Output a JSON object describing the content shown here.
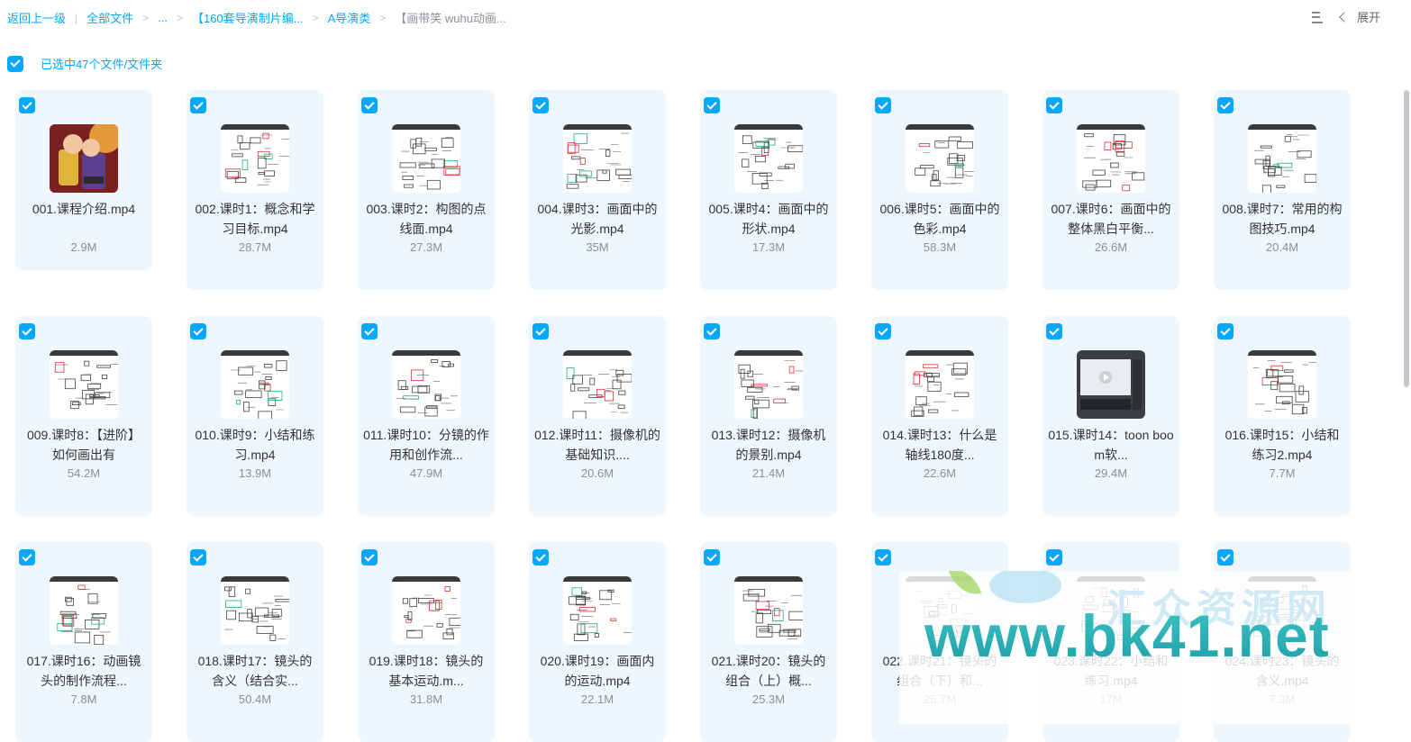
{
  "breadcrumb": {
    "back": "返回上一级",
    "root": "全部文件",
    "ellipsis": "...",
    "folder1": "【160套导演制片编...",
    "folder2": "A导演类",
    "current": "【画带笑 wuhu动画..."
  },
  "toolbar": {
    "expand_label": "展开"
  },
  "selection": {
    "label": "已选中47个文件/文件夹"
  },
  "files": [
    {
      "name": "001.课程介绍.mp4",
      "size": "2.9M",
      "thumb": "cover"
    },
    {
      "name": "002.课时1：概念和学习目标.mp4",
      "size": "28.7M",
      "thumb": "sketch"
    },
    {
      "name": "003.课时2：构图的点线面.mp4",
      "size": "27.3M",
      "thumb": "sketch"
    },
    {
      "name": "004.课时3：画面中的光影.mp4",
      "size": "35M",
      "thumb": "sketch"
    },
    {
      "name": "005.课时4：画面中的形状.mp4",
      "size": "17.3M",
      "thumb": "sketch"
    },
    {
      "name": "006.课时5：画面中的色彩.mp4",
      "size": "58.3M",
      "thumb": "sketch"
    },
    {
      "name": "007.课时6：画面中的整体黑白平衡...",
      "size": "26.6M",
      "thumb": "sketch"
    },
    {
      "name": "008.课时7：常用的构图技巧.mp4",
      "size": "20.4M",
      "thumb": "sketch"
    },
    {
      "name": "009.课时8：【进阶】如何画出有",
      "size": "54.2M",
      "thumb": "sketch"
    },
    {
      "name": "010.课时9：小结和练习.mp4",
      "size": "13.9M",
      "thumb": "sketch"
    },
    {
      "name": "011.课时10：分镜的作用和创作流...",
      "size": "47.9M",
      "thumb": "sketch"
    },
    {
      "name": "012.课时11：摄像机的基础知识....",
      "size": "20.6M",
      "thumb": "sketch"
    },
    {
      "name": "013.课时12：摄像机的景别.mp4",
      "size": "21.4M",
      "thumb": "sketch"
    },
    {
      "name": "014.课时13：什么是轴线180度...",
      "size": "22.6M",
      "thumb": "sketch"
    },
    {
      "name": "015.课时14：toon boom软...",
      "size": "29.4M",
      "thumb": "software"
    },
    {
      "name": "016.课时15：小结和练习2.mp4",
      "size": "7.7M",
      "thumb": "sketch"
    },
    {
      "name": "017.课时16：动画镜头的制作流程...",
      "size": "7.8M",
      "thumb": "sketch"
    },
    {
      "name": "018.课时17：镜头的含义（结合实...",
      "size": "50.4M",
      "thumb": "sketch"
    },
    {
      "name": "019.课时18：镜头的基本运动.m...",
      "size": "31.8M",
      "thumb": "sketch"
    },
    {
      "name": "020.课时19：画面内的运动.mp4",
      "size": "22.1M",
      "thumb": "sketch"
    },
    {
      "name": "021.课时20：镜头的组合（上）概...",
      "size": "25.3M",
      "thumb": "sketch"
    },
    {
      "name": "022.课时21：镜头的组合（下）和...",
      "size": "25.7M",
      "thumb": "sketch"
    },
    {
      "name": "023.课时22：小结和练习.mp4",
      "size": "17M",
      "thumb": "sketch"
    },
    {
      "name": "024.课时23：镜头的含义.mp4",
      "size": "7.3M",
      "thumb": "sketch"
    }
  ],
  "watermark": {
    "url": "www.bk41.net",
    "back_text": "汇众资源网"
  },
  "colors": {
    "accent": "#06a7ff",
    "card_bg": "#eef7fe",
    "muted": "#8a8f99"
  }
}
